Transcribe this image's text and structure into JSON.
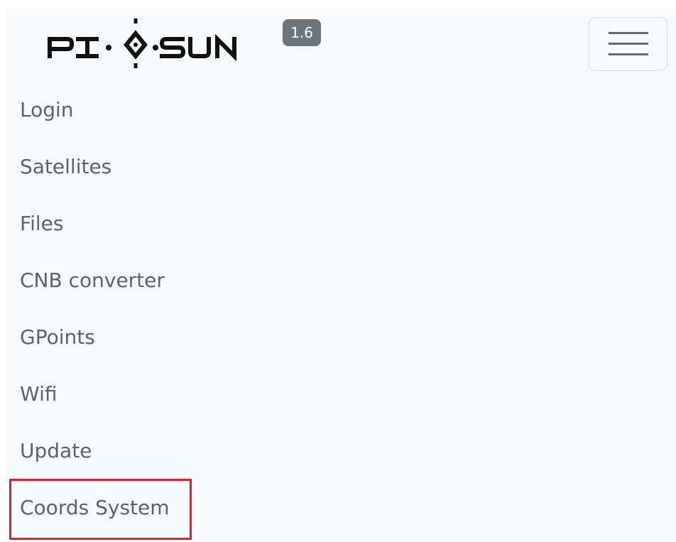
{
  "header": {
    "brand_name": "PI-O-SUN",
    "brand_icon": "compass-diamond-icon",
    "version": "1.6",
    "menu_toggle_icon": "hamburger-menu-icon"
  },
  "nav": {
    "items": [
      {
        "label": "Login"
      },
      {
        "label": "Satellites"
      },
      {
        "label": "Files"
      },
      {
        "label": "CNB converter"
      },
      {
        "label": "GPoints"
      },
      {
        "label": "Wifi"
      },
      {
        "label": "Update"
      },
      {
        "label": "Coords System",
        "highlighted": true
      }
    ]
  },
  "colors": {
    "panel_bg": "#f8f9fa",
    "badge_bg": "#6c757d",
    "link_text": "#5f6367",
    "highlight": "#e01e23"
  }
}
